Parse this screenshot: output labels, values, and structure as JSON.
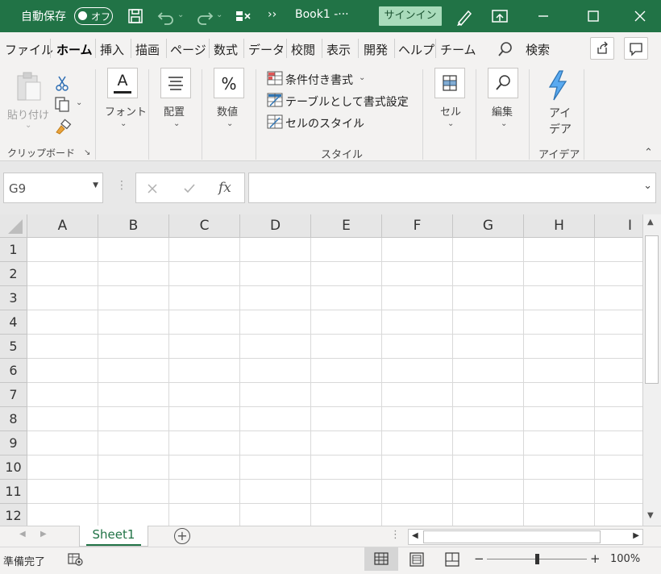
{
  "titlebar": {
    "autosave_label": "自動保存",
    "autosave_state": "オフ",
    "qat_more": "››",
    "doc_title": "Book1  -···",
    "signin": "サインイン"
  },
  "tabs": [
    "ファイル",
    "ホーム",
    "挿入",
    "描画",
    "ページ",
    "数式",
    "データ",
    "校閲",
    "表示",
    "開発",
    "ヘルプ",
    "チーム"
  ],
  "search_label": "検索",
  "ribbon": {
    "paste": "貼り付け",
    "clipboard": "クリップボード",
    "font": "フォント",
    "font_icon": "A",
    "alignment": "配置",
    "number": "数値",
    "number_icon": "%",
    "cond_format": "条件付き書式",
    "table_format": "テーブルとして書式設定",
    "cell_style": "セルのスタイル",
    "style_group": "スタイル",
    "cells": "セル",
    "editing": "編集",
    "ideas_line1": "アイ",
    "ideas_line2": "デア",
    "ideas_group": "アイデア"
  },
  "formula": {
    "namebox": "G9",
    "fx": "fx",
    "value": ""
  },
  "columns": [
    "A",
    "B",
    "C",
    "D",
    "E",
    "F",
    "G",
    "H",
    "I"
  ],
  "rows": [
    "1",
    "2",
    "3",
    "4",
    "5",
    "6",
    "7",
    "8",
    "9",
    "10",
    "11",
    "12"
  ],
  "sheet": {
    "name": "Sheet1",
    "add": "+"
  },
  "status": {
    "mode": "準備完了",
    "zoom_minus": "−",
    "zoom_plus": "+",
    "zoom": "100%",
    "zoom_level": 1.0
  },
  "colors": {
    "excel_green": "#217346"
  }
}
